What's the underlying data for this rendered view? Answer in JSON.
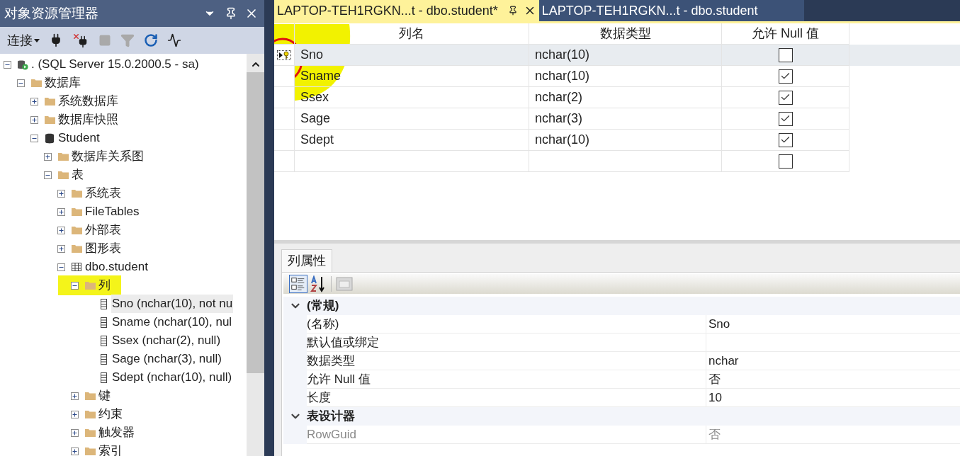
{
  "explorer": {
    "title": "对象资源管理器",
    "connect_label": "连接",
    "toolbar": [
      {
        "kind": "connect",
        "disabled": false
      },
      {
        "kind": "disconnect",
        "disabled": false
      },
      {
        "kind": "stop",
        "disabled": true
      },
      {
        "kind": "filter",
        "disabled": true
      },
      {
        "kind": "refresh",
        "disabled": false
      },
      {
        "kind": "activity",
        "disabled": false
      }
    ],
    "tree": [
      {
        "label": ". (SQL Server 15.0.2000.5 - sa)",
        "kind": "server",
        "expanded": true,
        "children": [
          {
            "label": "数据库",
            "kind": "folder",
            "expanded": true,
            "children": [
              {
                "label": "系统数据库",
                "kind": "folder",
                "expanded": false
              },
              {
                "label": "数据库快照",
                "kind": "folder",
                "expanded": false
              },
              {
                "label": "Student",
                "kind": "database",
                "expanded": true,
                "children": [
                  {
                    "label": "数据库关系图",
                    "kind": "folder",
                    "expanded": false
                  },
                  {
                    "label": "表",
                    "kind": "folder",
                    "expanded": true,
                    "children": [
                      {
                        "label": "系统表",
                        "kind": "folder",
                        "expanded": false
                      },
                      {
                        "label": "FileTables",
                        "kind": "folder",
                        "expanded": false
                      },
                      {
                        "label": "外部表",
                        "kind": "folder",
                        "expanded": false
                      },
                      {
                        "label": "图形表",
                        "kind": "folder",
                        "expanded": false
                      },
                      {
                        "label": "dbo.student",
                        "kind": "table",
                        "expanded": true,
                        "children": [
                          {
                            "label": "列",
                            "kind": "folder",
                            "expanded": true,
                            "highlighted": true,
                            "children": [
                              {
                                "label": "Sno (nchar(10), not nu",
                                "kind": "column",
                                "selected": true
                              },
                              {
                                "label": "Sname (nchar(10), nul",
                                "kind": "column",
                                "selected": false
                              },
                              {
                                "label": "Ssex (nchar(2), null)",
                                "kind": "column",
                                "selected": false
                              },
                              {
                                "label": "Sage (nchar(3), null)",
                                "kind": "column",
                                "selected": false
                              },
                              {
                                "label": "Sdept (nchar(10), null)",
                                "kind": "column",
                                "selected": false
                              }
                            ]
                          },
                          {
                            "label": "键",
                            "kind": "folder",
                            "expanded": false
                          },
                          {
                            "label": "约束",
                            "kind": "folder",
                            "expanded": false
                          },
                          {
                            "label": "触发器",
                            "kind": "folder",
                            "expanded": false
                          },
                          {
                            "label": "索引",
                            "kind": "folder",
                            "expanded": false
                          }
                        ]
                      }
                    ]
                  }
                ]
              }
            ]
          }
        ]
      }
    ]
  },
  "tabs": [
    {
      "label": "LAPTOP-TEH1RGKN...t - dbo.student*",
      "selected": true
    },
    {
      "label": "LAPTOP-TEH1RGKN...t - dbo.student",
      "selected": false
    }
  ],
  "designer": {
    "columns": [
      "列名",
      "数据类型",
      "允许 Null 值"
    ],
    "rows": [
      {
        "name": "Sno",
        "type": "nchar(10)",
        "allow_null": false,
        "primary_key": true,
        "selected": true
      },
      {
        "name": "Sname",
        "type": "nchar(10)",
        "allow_null": true,
        "primary_key": false,
        "selected": false
      },
      {
        "name": "Ssex",
        "type": "nchar(2)",
        "allow_null": true,
        "primary_key": false,
        "selected": false
      },
      {
        "name": "Sage",
        "type": "nchar(3)",
        "allow_null": true,
        "primary_key": false,
        "selected": false
      },
      {
        "name": "Sdept",
        "type": "nchar(10)",
        "allow_null": true,
        "primary_key": false,
        "selected": false
      },
      {
        "allow_null": false,
        "primary_key": false,
        "selected": false
      }
    ]
  },
  "properties": {
    "tab": "列属性",
    "categories": [
      {
        "label": "(常规)",
        "expanded": true,
        "rows": [
          {
            "name": "(名称)",
            "value": "Sno",
            "disabled": false
          },
          {
            "name": "默认值或绑定",
            "disabled": false
          },
          {
            "name": "数据类型",
            "value": "nchar",
            "disabled": false
          },
          {
            "name": "允许 Null 值",
            "value": "否",
            "disabled": false
          },
          {
            "name": "长度",
            "value": "10",
            "disabled": false
          }
        ]
      },
      {
        "label": "表设计器",
        "expanded": true,
        "rows": [
          {
            "name": "RowGuid",
            "value": "否",
            "disabled": true
          }
        ]
      }
    ]
  }
}
